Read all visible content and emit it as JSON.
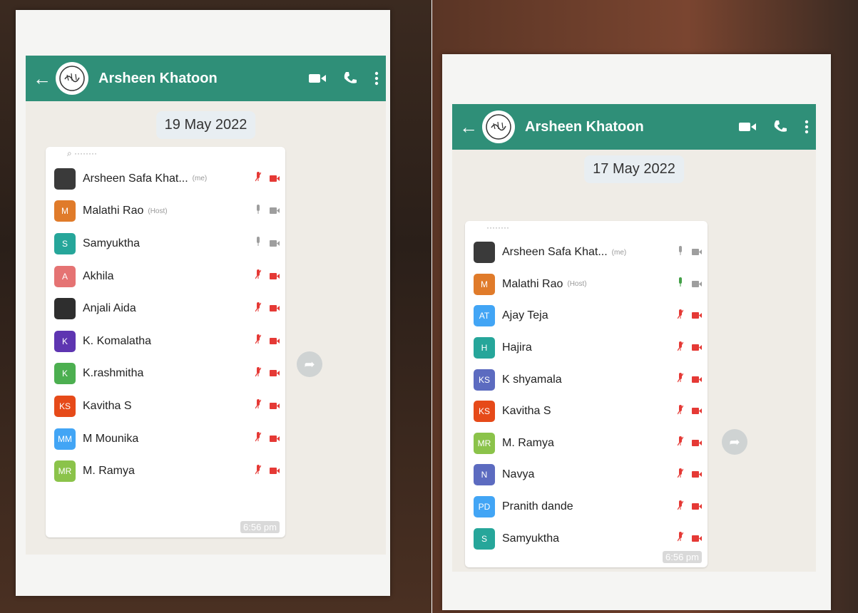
{
  "left": {
    "contact_name": "Arsheen Khatoon",
    "date": "19 May 2022",
    "timestamp": "6:56 pm",
    "participants": [
      {
        "name": "Arsheen Safa Khat...",
        "tag": "(me)",
        "initials": "",
        "color": "#3a3a3a",
        "mic": "muted"
      },
      {
        "name": "Malathi Rao",
        "tag": "(Host)",
        "initials": "M",
        "color": "#e07b2a",
        "mic": "on"
      },
      {
        "name": "Samyuktha",
        "tag": "",
        "initials": "S",
        "color": "#26a69a",
        "mic": "on"
      },
      {
        "name": "Akhila",
        "tag": "",
        "initials": "A",
        "color": "#e57373",
        "mic": "muted"
      },
      {
        "name": "Anjali Aida",
        "tag": "",
        "initials": "",
        "color": "#2e2e2e",
        "mic": "muted"
      },
      {
        "name": "K. Komalatha",
        "tag": "",
        "initials": "K",
        "color": "#5e35b1",
        "mic": "muted"
      },
      {
        "name": "K.rashmitha",
        "tag": "",
        "initials": "K",
        "color": "#4caf50",
        "mic": "muted"
      },
      {
        "name": "Kavitha S",
        "tag": "",
        "initials": "KS",
        "color": "#e64a19",
        "mic": "muted"
      },
      {
        "name": "M Mounika",
        "tag": "",
        "initials": "MM",
        "color": "#42a5f5",
        "mic": "muted"
      },
      {
        "name": "M. Ramya",
        "tag": "",
        "initials": "MR",
        "color": "#8bc34a",
        "mic": "muted"
      }
    ]
  },
  "right": {
    "contact_name": "Arsheen Khatoon",
    "date": "17 May 2022",
    "timestamp": "6:56 pm",
    "participants": [
      {
        "name": "Arsheen Safa Khat...",
        "tag": "(me)",
        "initials": "",
        "color": "#3a3a3a",
        "mic": "on"
      },
      {
        "name": "Malathi Rao",
        "tag": "(Host)",
        "initials": "M",
        "color": "#e07b2a",
        "mic": "active"
      },
      {
        "name": "Ajay Teja",
        "tag": "",
        "initials": "AT",
        "color": "#42a5f5",
        "mic": "muted"
      },
      {
        "name": "Hajira",
        "tag": "",
        "initials": "H",
        "color": "#26a69a",
        "mic": "muted"
      },
      {
        "name": "K shyamala",
        "tag": "",
        "initials": "KS",
        "color": "#5c6bc0",
        "mic": "muted"
      },
      {
        "name": "Kavitha S",
        "tag": "",
        "initials": "KS",
        "color": "#e64a19",
        "mic": "muted"
      },
      {
        "name": "M. Ramya",
        "tag": "",
        "initials": "MR",
        "color": "#8bc34a",
        "mic": "muted"
      },
      {
        "name": "Navya",
        "tag": "",
        "initials": "N",
        "color": "#5c6bc0",
        "mic": "muted"
      },
      {
        "name": "Pranith dande",
        "tag": "",
        "initials": "PD",
        "color": "#42a5f5",
        "mic": "muted"
      },
      {
        "name": "Samyuktha",
        "tag": "",
        "initials": "S",
        "color": "#26a69a",
        "mic": "muted"
      }
    ]
  },
  "colors": {
    "header": "#2f8f78",
    "muted": "#e53935",
    "active": "#43a047",
    "off": "#9e9e9e"
  },
  "icons": [
    "back-arrow-icon",
    "video-call-icon",
    "phone-icon",
    "more-vert-icon",
    "share-icon",
    "mic-icon",
    "camera-icon"
  ]
}
